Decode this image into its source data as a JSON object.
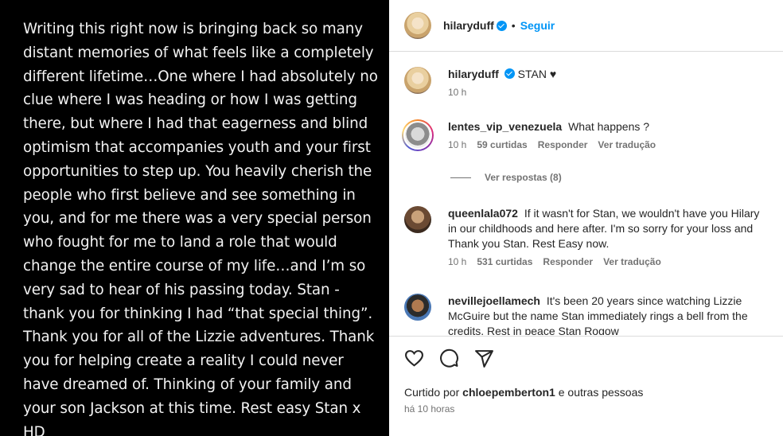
{
  "post_image": {
    "lines": [
      "Writing this right now is bringing back so many",
      "distant memories of what feels like a completely",
      "different lifetime…One where I had absolutely no",
      "clue where I was heading or how I was getting",
      "there, but where I had that eagerness and blind",
      "optimism that accompanies youth and your first",
      "opportunities to step up.  You heavily cherish the",
      "people who first believe and see something in",
      "you, and for me there was a very special person",
      "who fought for me to land a role that would",
      "change the entire course of my life…and I’m so",
      "very sad to hear of his passing today.  Stan -",
      "thank you for thinking I had “that special thing”.",
      "Thank you for all of the Lizzie adventures. Thank",
      "you for helping create a reality I could never",
      "have dreamed of.  Thinking of your family and",
      "your son Jackson at this time. Rest easy Stan  x",
      "HD"
    ]
  },
  "header": {
    "username": "hilaryduff",
    "separator": "•",
    "follow_label": "Seguir"
  },
  "caption": {
    "username": "hilaryduff",
    "text": "STAN ♥",
    "time": "10 h"
  },
  "comments": [
    {
      "username": "lentes_vip_venezuela",
      "text": "What happens ?",
      "time": "10 h",
      "likes": "59 curtidas",
      "reply": "Responder",
      "translate": "Ver tradução",
      "view_replies": "Ver respostas (8)"
    },
    {
      "username": "queenlala072",
      "line1": "If it wasn't for Stan, we wouldn't have you Hilary",
      "line2": "in our childhoods and here after. I'm so sorry for your loss and",
      "line3": "Thank you Stan. Rest Easy now.",
      "time": "10 h",
      "likes": "531 curtidas",
      "reply": "Responder",
      "translate": "Ver tradução"
    },
    {
      "username": "nevillejoellamech",
      "line1": "It's been 20 years since watching Lizzie",
      "line2": "McGuire but the name Stan immediately rings a bell from the",
      "line3": "credits. Rest in peace Stan Rogow"
    }
  ],
  "footer": {
    "liked_prefix": "Curtido por",
    "liked_user": "chloepemberton1",
    "liked_suffix": "e outras pessoas",
    "time": "há 10 horas"
  },
  "icons": [
    "heart-icon",
    "comment-icon",
    "share-icon"
  ],
  "colors": {
    "accent": "#0095f6",
    "muted": "#737373",
    "text": "#262626",
    "border": "#dbdbdb"
  }
}
